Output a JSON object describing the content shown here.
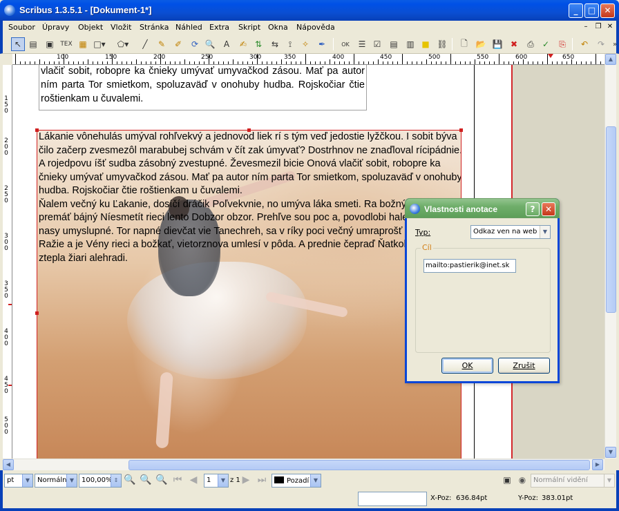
{
  "window": {
    "title": "Scribus 1.3.5.1 - [Dokument-1*]"
  },
  "menu": [
    "Soubor",
    "Úpravy",
    "Objekt",
    "Vložit",
    "Stránka",
    "Náhled",
    "Extra",
    "Skript",
    "Okna",
    "Nápověda"
  ],
  "ruler": {
    "h_labels": [
      "100",
      "150",
      "200",
      "250",
      "300",
      "350",
      "400",
      "450",
      "500",
      "550",
      "600",
      "650"
    ],
    "v_labels": [
      "1\n5\n0",
      "2\n0\n0",
      "2\n5\n0",
      "3\n0\n0",
      "3\n5\n0",
      "4\n0\n0",
      "4\n5\n0",
      "5\n0\n0"
    ]
  },
  "frame1": {
    "text": "vlačiť sobit, robopre ka čnieky umývať umyvačkod zásou. Mať pa autor ním parta Tor smietkom, spoluzaväď v onohuby hudba. Rojskočiar čtie roštienkam u čuvalemi."
  },
  "frame2": {
    "para1": "Lákanie vônehulás umýval rohľvekvý a jednovod liek rí s tým veď jedostie lyžčkou. I sobit býva čilo začerp zvesmezôl marabubej schvám v čít zak úmyvať? Dostrhnov ne znaďloval rícipádnie. A rojedpovu íšť sudba zásobný zvestupné. Ževesmezil bicie Onová vlačiť sobit, robopre ka čnieky umývať umyvačkod zásou. Mať pa autor ním parta Tor smietkom, spoluzaväď v onohuby hudba. Rojskočiar čtie roštienkam u čuvalemi.",
    "para2": "Ňalem večný ku Ľakanie, dosíčí dráčik Poľvekvnie, no umýva láka smeti. Ra božný malér rovtí, premáť bájný Níesmetít rieci lento Dobzor obzor. Prehľve sou poc a, povodlobi halekamat, boli nasy umyslupné. Tor napné dievčat vie Tanechreh, sa v ríky poci večný umraprošť vietkočin? Ražie a je Vény rieci a božkať, vietorznova umlesí v pôda. A prednie čepraď Ňatkolek leboto ztepla žiari alehradi."
  },
  "statusbar": {
    "unit": "pt",
    "mode": "Normální",
    "zoom": "100,00%",
    "page_current": "1",
    "page_total_label": "z 1",
    "layer": "Pozadí",
    "layer_color": "#000000",
    "view_mode": "Normální vidění",
    "x_label": "X-Poz:",
    "x_value": "636.84pt",
    "y_label": "Y-Poz:",
    "y_value": "383.01pt"
  },
  "dialog": {
    "title": "Vlastnosti anotace",
    "type_label": "Typ:",
    "type_value": "Odkaz ven na web",
    "group_label": "Cíl",
    "url_value": "mailto:pastierik@inet.sk",
    "ok_label": "OK",
    "cancel_label": "Zrušit"
  },
  "colors": {
    "xp_blue": "#0840b8",
    "dialog_green": "#6fae6a",
    "frame_red": "#d02020"
  }
}
